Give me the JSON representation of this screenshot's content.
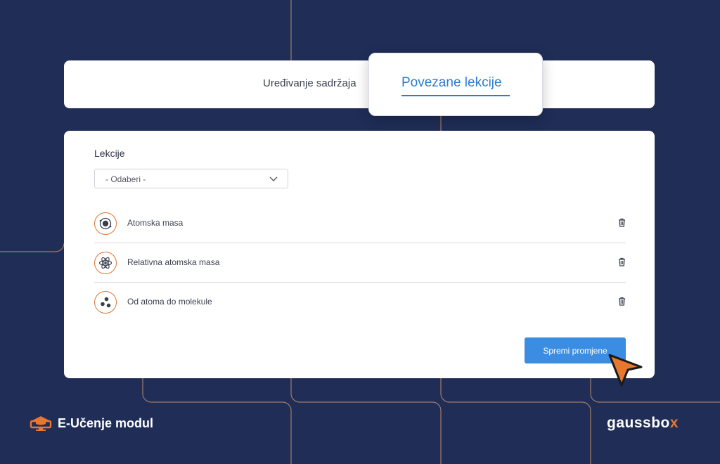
{
  "tabs": {
    "edit_label": "Uređivanje sadržaja",
    "linked_label": "Povezane lekcije"
  },
  "lessons_section": {
    "label": "Lekcije",
    "select_value": "- Odaberi -",
    "items": [
      {
        "title": "Atomska masa",
        "icon": "atom-core-icon"
      },
      {
        "title": "Relativna atomska masa",
        "icon": "atom-orbit-icon"
      },
      {
        "title": "Od atoma do molekule",
        "icon": "molecule-icon"
      }
    ]
  },
  "save_button": {
    "label": "Spremi promjene"
  },
  "footer": {
    "module_name": "E-Učenje modul",
    "brand_main": "gaussbo",
    "brand_accent": "x"
  },
  "colors": {
    "background": "#1f2d57",
    "accent_blue": "#2c7bd0",
    "button_blue": "#3b8de3",
    "accent_orange": "#e0773a"
  }
}
